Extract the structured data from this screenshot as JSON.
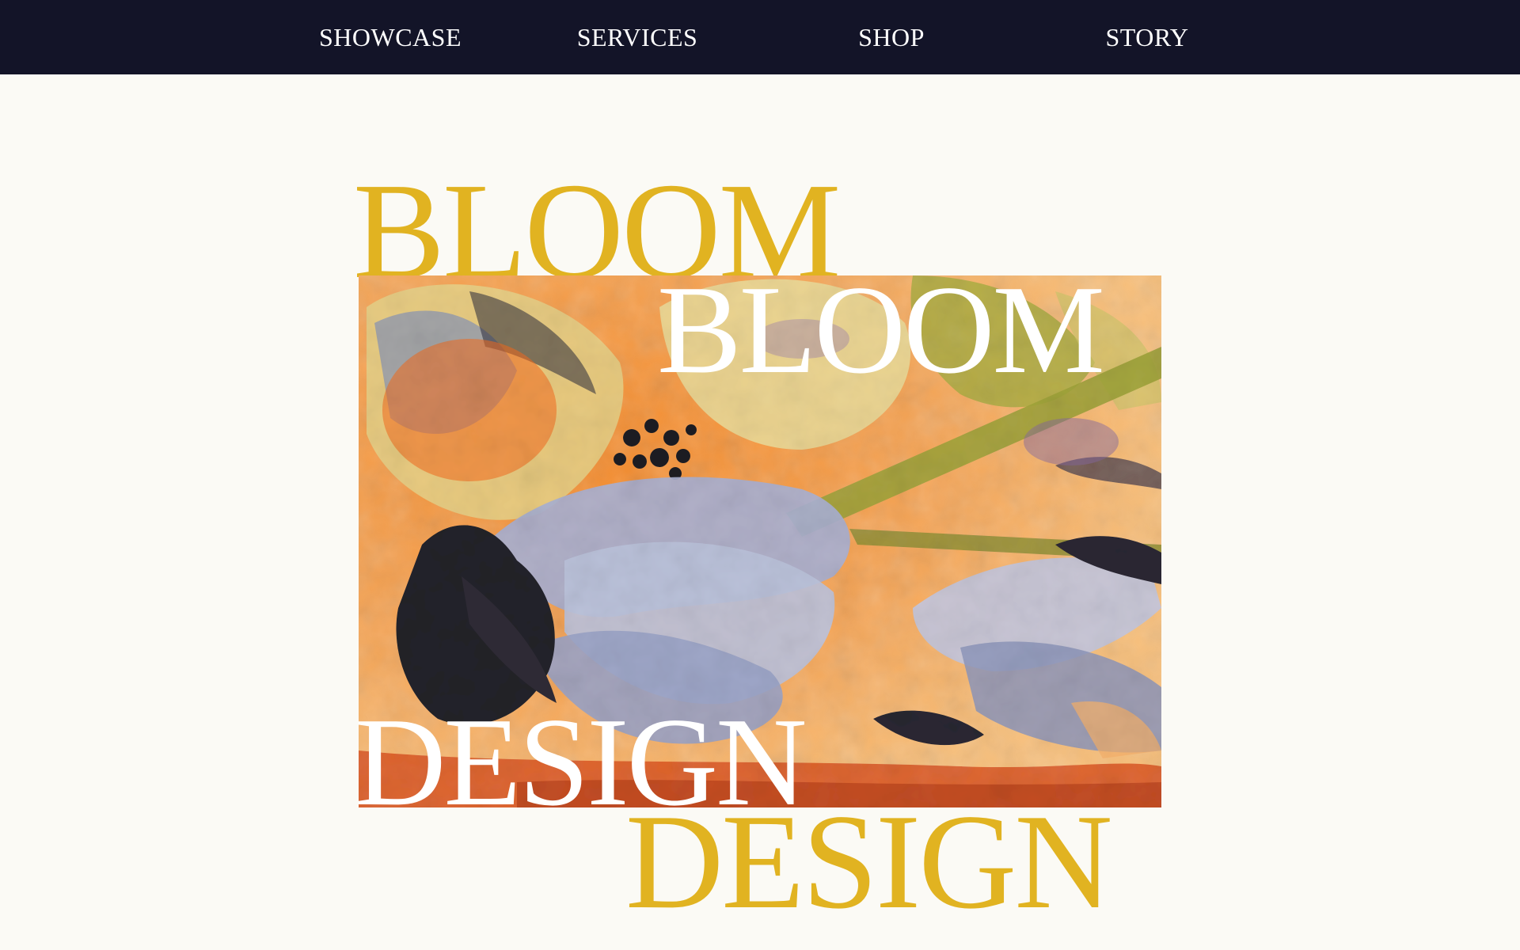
{
  "nav": {
    "items": [
      {
        "label": "SHOWCASE"
      },
      {
        "label": "SERVICES"
      },
      {
        "label": "SHOP"
      },
      {
        "label": "STORY"
      }
    ]
  },
  "hero": {
    "words": {
      "bloom_gold": "BLOOM",
      "bloom_white": "BLOOM",
      "design_white": "DESIGN",
      "design_gold": "DESIGN"
    },
    "artwork_icon": "watercolor-floral-artwork"
  },
  "colors": {
    "nav_background": "#131428",
    "page_background": "#fbfaf5",
    "accent_gold": "#e1b321",
    "text_white": "#ffffff"
  }
}
